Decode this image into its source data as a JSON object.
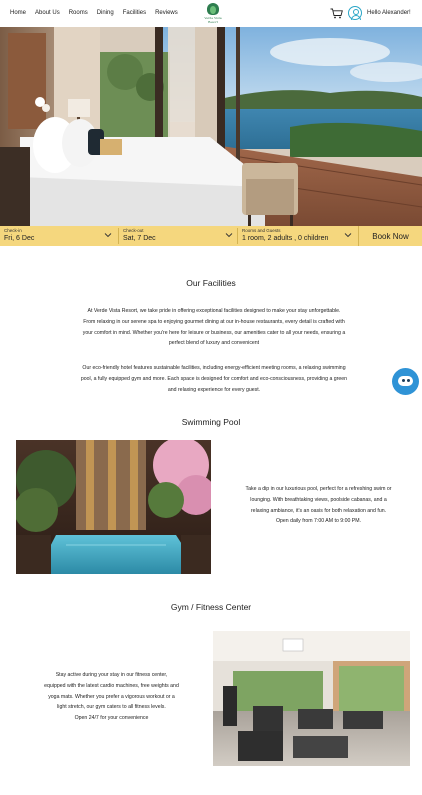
{
  "nav": {
    "links": [
      "Home",
      "About Us",
      "Rooms",
      "Dining",
      "Facilities",
      "Reviews"
    ],
    "logo_text": "Verde Vista Resort",
    "greeting": "Hello Alexander!"
  },
  "booking": {
    "checkin_label": "Check-in",
    "checkin_value": "Fri, 6 Dec",
    "checkout_label": "Check-out",
    "checkout_value": "Sat, 7 Dec",
    "guests_label": "Rooms and Guests",
    "guests_value": "1 room, 2 adults , 0 children",
    "book_label": "Book Now"
  },
  "facilities": {
    "title": "Our Facilities",
    "para1": [
      "At Verde Vista Resort, we take pride in offering exceptional facilities designed to make your stay unforgettable.",
      "From relaxing in our serene spa to enjoying gourmet dining at our in-house restaurants, every detail is crafted with",
      "your comfort in mind.  Whether you're here for leisure or business, our amenities cater to all your needs, ensuring a",
      "perfect blend of luxury and convenicent"
    ],
    "para2": [
      "Our eco-friendly hotel features sustainable facilities, including energy-efficient meeting rooms, a relaxing swimming",
      "pool,  a fully equipped gym and more. Each space is designed for comfort and eco-consciousness, providing a green",
      "and relaxing experience for every guest."
    ]
  },
  "pool": {
    "title": "Swimming Pool",
    "lines": [
      "Take a dip in our luxurious pool, perfect for a refreshing swim or",
      "lounging. With breathtaking views, poolside cabanas, and a",
      "relaxing ambiance, it's an oasis for both relaxation and fun.",
      "Open daily from 7:00 AM to 9:00 PM."
    ]
  },
  "gym": {
    "title": "Gym / Fitness Center",
    "lines": [
      "Stay active during your stay in our fitness center,",
      "equipped with the latest cardio machines, free weights and",
      "yoga mats. Whether you prefer a vigorous workout or a",
      "light stretch, our gym caters to all fitness levels.",
      "Open 24/7 for your convenience"
    ]
  },
  "colors": {
    "booking_bar": "#f5d77e",
    "accent": "#2aa6c7",
    "chat": "#2f93d6"
  },
  "icons": [
    "cart-icon",
    "user-icon",
    "chevron-down-icon",
    "chat-bot-icon"
  ]
}
